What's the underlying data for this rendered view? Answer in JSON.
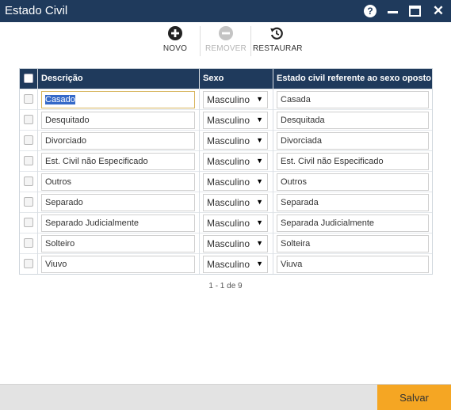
{
  "window": {
    "title": "Estado Civil"
  },
  "toolbar": {
    "novo_label": "NOVO",
    "remover_label": "REMOVER",
    "restaurar_label": "RESTAURAR"
  },
  "grid": {
    "headers": {
      "descricao": "Descrição",
      "sexo": "Sexo",
      "oposto": "Estado civil referente ao sexo oposto"
    },
    "rows": [
      {
        "descricao": "Casado",
        "sexo": "Masculino",
        "oposto": "Casada"
      },
      {
        "descricao": "Desquitado",
        "sexo": "Masculino",
        "oposto": "Desquitada"
      },
      {
        "descricao": "Divorciado",
        "sexo": "Masculino",
        "oposto": "Divorciada"
      },
      {
        "descricao": "Est. Civil não Especificado",
        "sexo": "Masculino",
        "oposto": "Est. Civil não Especificado"
      },
      {
        "descricao": "Outros",
        "sexo": "Masculino",
        "oposto": "Outros"
      },
      {
        "descricao": "Separado",
        "sexo": "Masculino",
        "oposto": "Separada"
      },
      {
        "descricao": "Separado Judicialmente",
        "sexo": "Masculino",
        "oposto": "Separada Judicialmente"
      },
      {
        "descricao": "Solteiro",
        "sexo": "Masculino",
        "oposto": "Solteira"
      },
      {
        "descricao": "Viuvo",
        "sexo": "Masculino",
        "oposto": "Viuva"
      }
    ]
  },
  "pager": {
    "text": "1 - 1 de 9"
  },
  "footer": {
    "save_label": "Salvar"
  },
  "colors": {
    "header_bg": "#1f3a5c",
    "save_bg": "#f5a623"
  },
  "icons": {
    "novo": "plus-circle-icon",
    "remover": "minus-circle-icon",
    "restaurar": "restore-icon"
  }
}
